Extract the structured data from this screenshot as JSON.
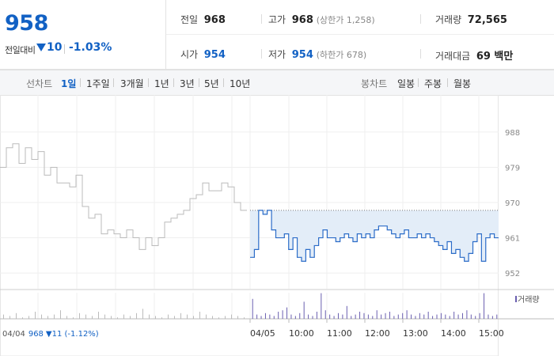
{
  "quote": {
    "price": "958",
    "change_label": "전일대비",
    "change_amount": "10",
    "change_pct": "-1.03%",
    "prev_close_label": "전일",
    "prev_close": "968",
    "high_label": "고가",
    "high": "968",
    "upper_limit": "(상한가 1,258)",
    "volume_label": "거래량",
    "volume": "72,565",
    "open_label": "시가",
    "open": "954",
    "low_label": "저가",
    "low": "954",
    "lower_limit": "(하한가 678)",
    "value_label": "거래대금",
    "value": "69 백만"
  },
  "toolbar": {
    "line_label": "선차트",
    "periods": [
      "1일",
      "1주일",
      "3개월",
      "1년",
      "3년",
      "5년",
      "10년"
    ],
    "active_period": "1일",
    "candle_label": "봉차트",
    "candles": [
      "일봉",
      "주봉",
      "월봉"
    ]
  },
  "chart_data": {
    "type": "line",
    "y_ticks": [
      "988",
      "979",
      "970",
      "961",
      "952"
    ],
    "ylim": [
      950,
      990
    ],
    "x_ticks": [
      "04/04",
      "04/05",
      "10:00",
      "11:00",
      "12:00",
      "13:00",
      "14:00",
      "15:00"
    ],
    "prev_session_label": "04/04",
    "prev_session_close": "968",
    "prev_session_change": "11 (-1.12%)",
    "prev_day_reference": 968,
    "volume_legend": "거래량",
    "series": [
      {
        "name": "04/04",
        "color": "#bbbbbb",
        "values": [
          979,
          984,
          985,
          980,
          984,
          981,
          983,
          977,
          979,
          975,
          975,
          974,
          977,
          969,
          966,
          967,
          962,
          963,
          962,
          961,
          963,
          961,
          958,
          961,
          959,
          961,
          965,
          966,
          967,
          968,
          971,
          972,
          975,
          973,
          973,
          975,
          974,
          970,
          968
        ]
      },
      {
        "name": "04/05",
        "color": "#2b6cc8",
        "values": [
          956,
          958,
          968,
          967,
          968,
          963,
          961,
          961,
          962,
          958,
          961,
          956,
          955,
          958,
          956,
          959,
          961,
          963,
          961,
          961,
          960,
          961,
          962,
          961,
          960,
          962,
          961,
          962,
          961,
          963,
          964,
          964,
          963,
          962,
          961,
          962,
          963,
          961,
          961,
          962,
          961,
          962,
          961,
          960,
          959,
          958,
          960,
          957,
          958,
          956,
          955,
          957,
          960,
          962,
          955,
          961,
          962,
          961
        ]
      }
    ],
    "volume": {
      "prev": [
        3,
        2,
        4,
        1,
        2,
        5,
        3,
        2,
        3,
        6,
        2,
        1,
        4,
        3,
        2,
        5,
        3,
        2,
        1,
        3,
        2,
        4,
        7,
        3,
        2,
        1,
        3,
        2,
        4,
        3,
        2,
        5,
        3,
        2,
        1,
        2,
        3,
        2,
        1
      ],
      "today": [
        14,
        3,
        2,
        4,
        3,
        2,
        5,
        6,
        8,
        3,
        2,
        4,
        12,
        3,
        2,
        5,
        18,
        6,
        3,
        2,
        4,
        3,
        9,
        2,
        3,
        5,
        4,
        3,
        2,
        6,
        3,
        4,
        5,
        2,
        3,
        4,
        6,
        3,
        2,
        4,
        3,
        5,
        2,
        3,
        4,
        3,
        2,
        5,
        3,
        4,
        6,
        3,
        2,
        4,
        18,
        3,
        2,
        3
      ]
    }
  }
}
